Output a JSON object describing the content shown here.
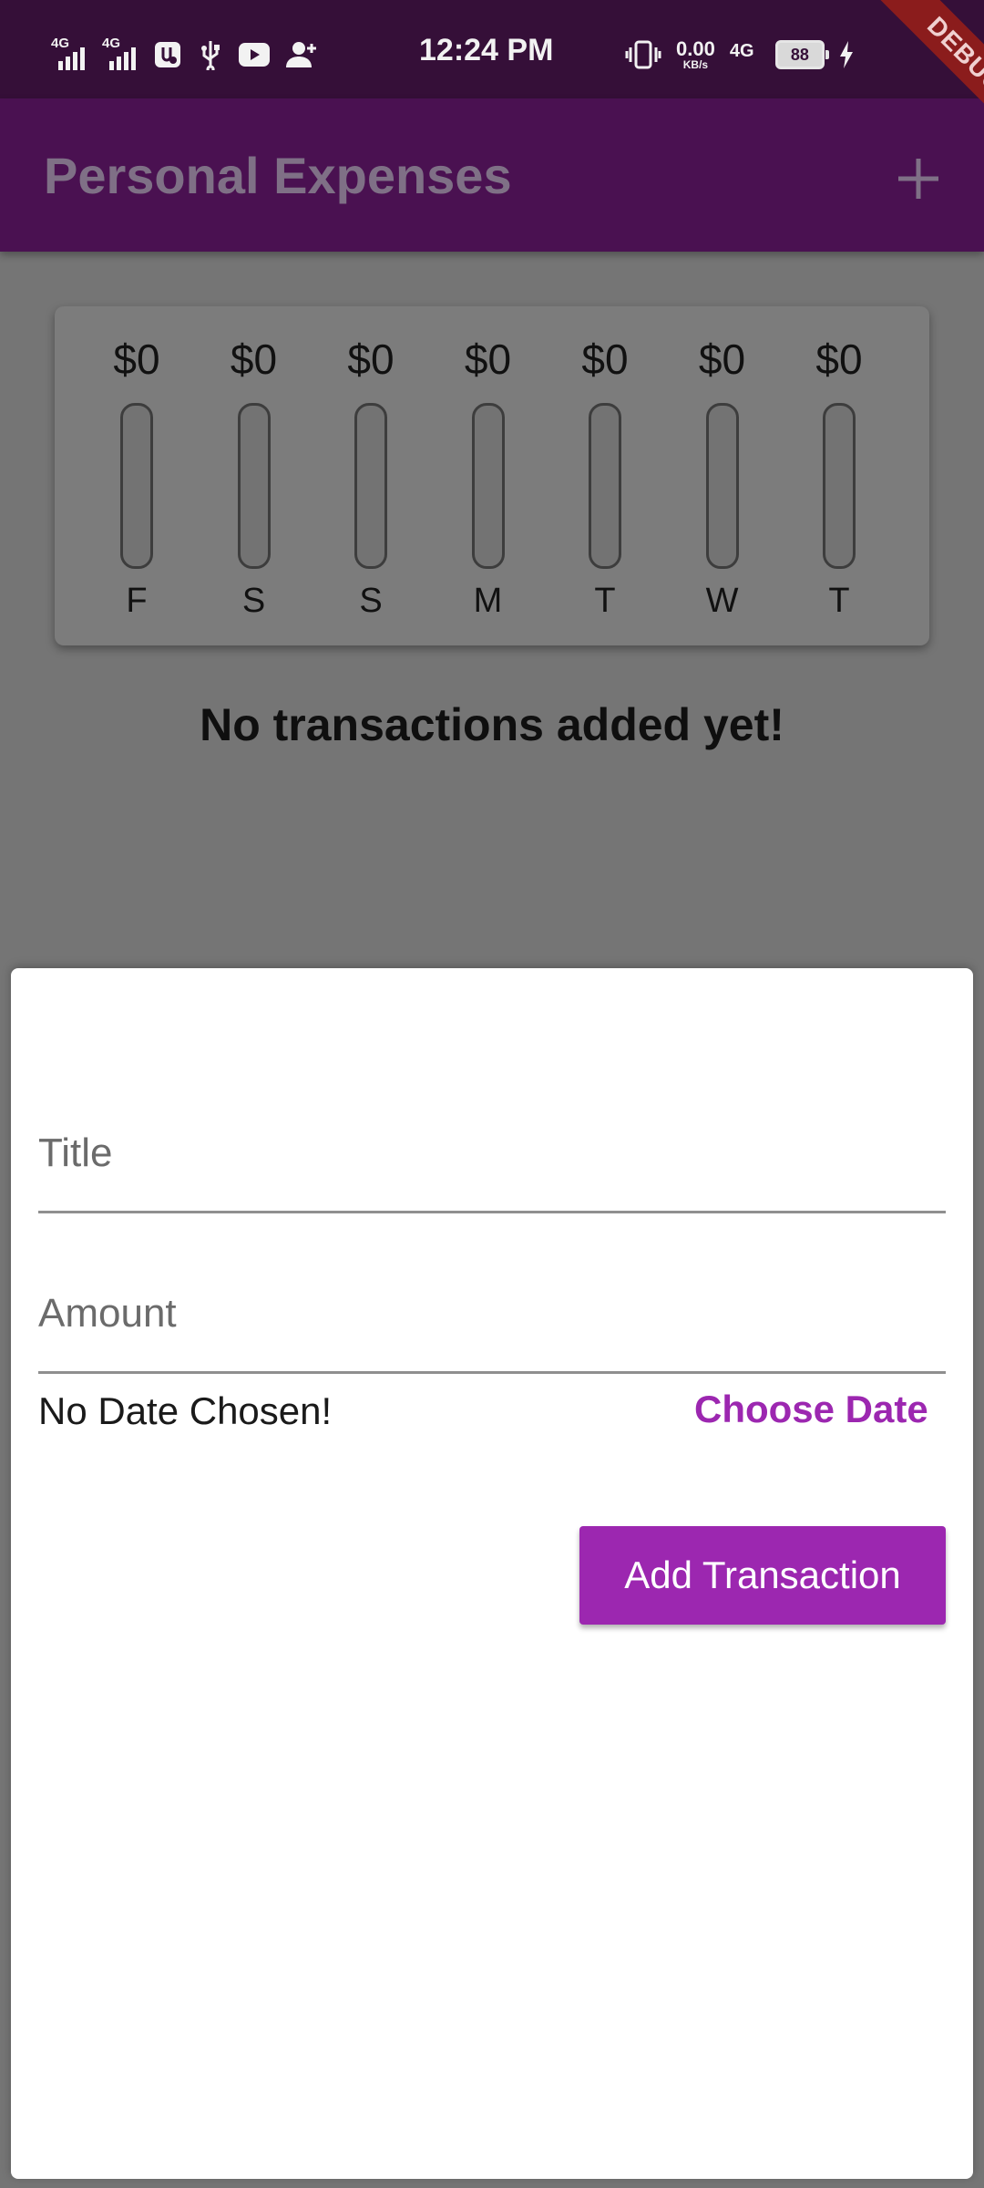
{
  "status_bar": {
    "network_1": "4G",
    "network_2": "4G",
    "time": "12:24 PM",
    "data_speed": "0.00",
    "data_speed_unit": "KB/s",
    "network_3": "4G",
    "battery": "88"
  },
  "app_bar": {
    "title": "Personal Expenses"
  },
  "chart_data": {
    "type": "bar",
    "categories": [
      "F",
      "S",
      "S",
      "M",
      "T",
      "W",
      "T"
    ],
    "values": [
      0,
      0,
      0,
      0,
      0,
      0,
      0
    ],
    "labels": [
      "$0",
      "$0",
      "$0",
      "$0",
      "$0",
      "$0",
      "$0"
    ]
  },
  "empty_state": {
    "message": "No transactions added yet!"
  },
  "form": {
    "title_placeholder": "Title",
    "amount_placeholder": "Amount",
    "date_status": "No Date Chosen!",
    "choose_date_label": "Choose Date",
    "submit_label": "Add Transaction"
  },
  "debug_banner": "DEBUG",
  "colors": {
    "primary": "#9c27b0",
    "app_bar": "#4a1151",
    "status_bar": "#350f38"
  }
}
